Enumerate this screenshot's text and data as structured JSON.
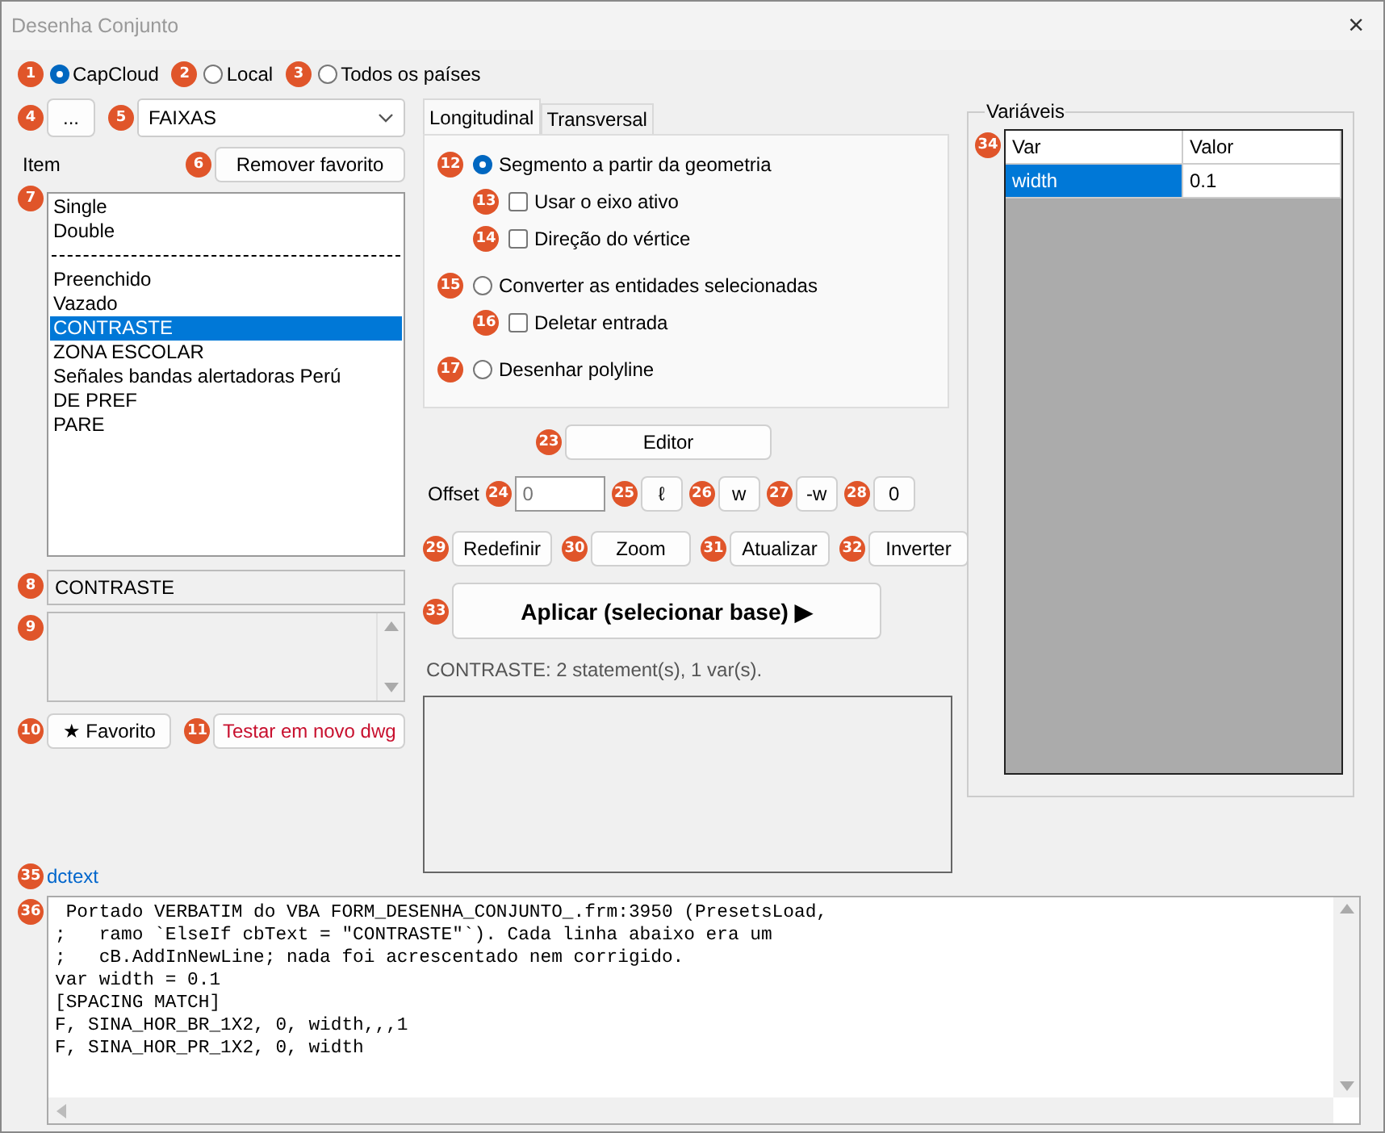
{
  "window": {
    "title": "Desenha Conjunto",
    "close": "×"
  },
  "source_options": [
    {
      "label": "CapCloud",
      "selected": true,
      "badge": "1"
    },
    {
      "label": "Local",
      "selected": false,
      "badge": "2"
    },
    {
      "label": "Todos os países",
      "selected": false,
      "badge": "3"
    }
  ],
  "browse_button": {
    "label": "...",
    "badge": "4"
  },
  "category": {
    "value": "FAIXAS",
    "badge": "5"
  },
  "item_label": "Item",
  "remove_favorite": {
    "label": "Remover favorito",
    "badge": "6"
  },
  "items": {
    "badge": "7",
    "entries": [
      {
        "kind": "item",
        "text": "Single",
        "selected": false
      },
      {
        "kind": "item",
        "text": "Double",
        "selected": false
      },
      {
        "kind": "separator"
      },
      {
        "kind": "item",
        "text": "Preenchido",
        "selected": false
      },
      {
        "kind": "item",
        "text": "Vazado",
        "selected": false
      },
      {
        "kind": "item",
        "text": "CONTRASTE",
        "selected": true
      },
      {
        "kind": "item",
        "text": "ZONA ESCOLAR",
        "selected": false
      },
      {
        "kind": "item",
        "text": "Señales bandas alertadoras Perú",
        "selected": false
      },
      {
        "kind": "item",
        "text": "DE PREF",
        "selected": false
      },
      {
        "kind": "item",
        "text": "PARE",
        "selected": false
      }
    ]
  },
  "selected_name": {
    "value": "CONTRASTE",
    "badge": "8"
  },
  "notes_box": {
    "badge": "9"
  },
  "favorite_button": {
    "label": "★ Favorito",
    "badge": "10"
  },
  "test_button": {
    "label": "Testar em novo dwg",
    "badge": "11"
  },
  "tabs": [
    {
      "label": "Longitudinal",
      "selected": true
    },
    {
      "label": "Transversal",
      "selected": false
    }
  ],
  "options": [
    {
      "kind": "radio",
      "label": "Segmento a partir da geometria",
      "checked": true,
      "badge": "12",
      "children": [
        {
          "kind": "checkbox",
          "label": "Usar o eixo ativo",
          "checked": false,
          "badge": "13"
        },
        {
          "kind": "checkbox",
          "label": "Direção do vértice",
          "checked": false,
          "badge": "14"
        }
      ]
    },
    {
      "kind": "radio",
      "label": "Converter as entidades selecionadas",
      "checked": false,
      "badge": "15",
      "children": [
        {
          "kind": "checkbox",
          "label": "Deletar entrada",
          "checked": false,
          "badge": "16"
        }
      ]
    },
    {
      "kind": "radio",
      "label": "Desenhar polyline",
      "checked": false,
      "badge": "17"
    }
  ],
  "editor_button": {
    "label": "Editor",
    "badge": "23"
  },
  "offset": {
    "label": "Offset",
    "placeholder": "0",
    "badge": "24"
  },
  "offset_buttons": [
    {
      "label": "ℓ",
      "badge": "25"
    },
    {
      "label": "w",
      "badge": "26"
    },
    {
      "label": "-w",
      "badge": "27"
    },
    {
      "label": "0",
      "badge": "28"
    }
  ],
  "action_buttons": [
    {
      "label": "Redefinir",
      "badge": "29"
    },
    {
      "label": "Zoom",
      "badge": "30"
    },
    {
      "label": "Atualizar",
      "badge": "31"
    },
    {
      "label": "Inverter",
      "badge": "32"
    }
  ],
  "apply_button": {
    "label": "Aplicar (selecionar base) ▶",
    "badge": "33"
  },
  "status": "CONTRASTE: 2 statement(s), 1 var(s).",
  "variables": {
    "title": "Variáveis",
    "badge": "34",
    "columns": [
      "Var",
      "Valor"
    ],
    "rows": [
      {
        "cells": [
          "width",
          "0.1"
        ],
        "selected": true
      }
    ]
  },
  "link": {
    "text": "dctext",
    "badge": "35"
  },
  "code": {
    "badge": "36",
    "lines": [
      " Portado VERBATIM do VBA FORM_DESENHA_CONJUNTO_.frm:3950 (PresetsLoad,",
      ";   ramo `ElseIf cbText = \"CONTRASTE\"`). Cada linha abaixo era um",
      ";   cB.AddInNewLine; nada foi acrescentado nem corrigido.",
      "var width = 0.1",
      "[SPACING MATCH]",
      "F, SINA_HOR_BR_1X2, 0, width,,,1",
      "F, SINA_HOR_PR_1X2, 0, width"
    ]
  }
}
